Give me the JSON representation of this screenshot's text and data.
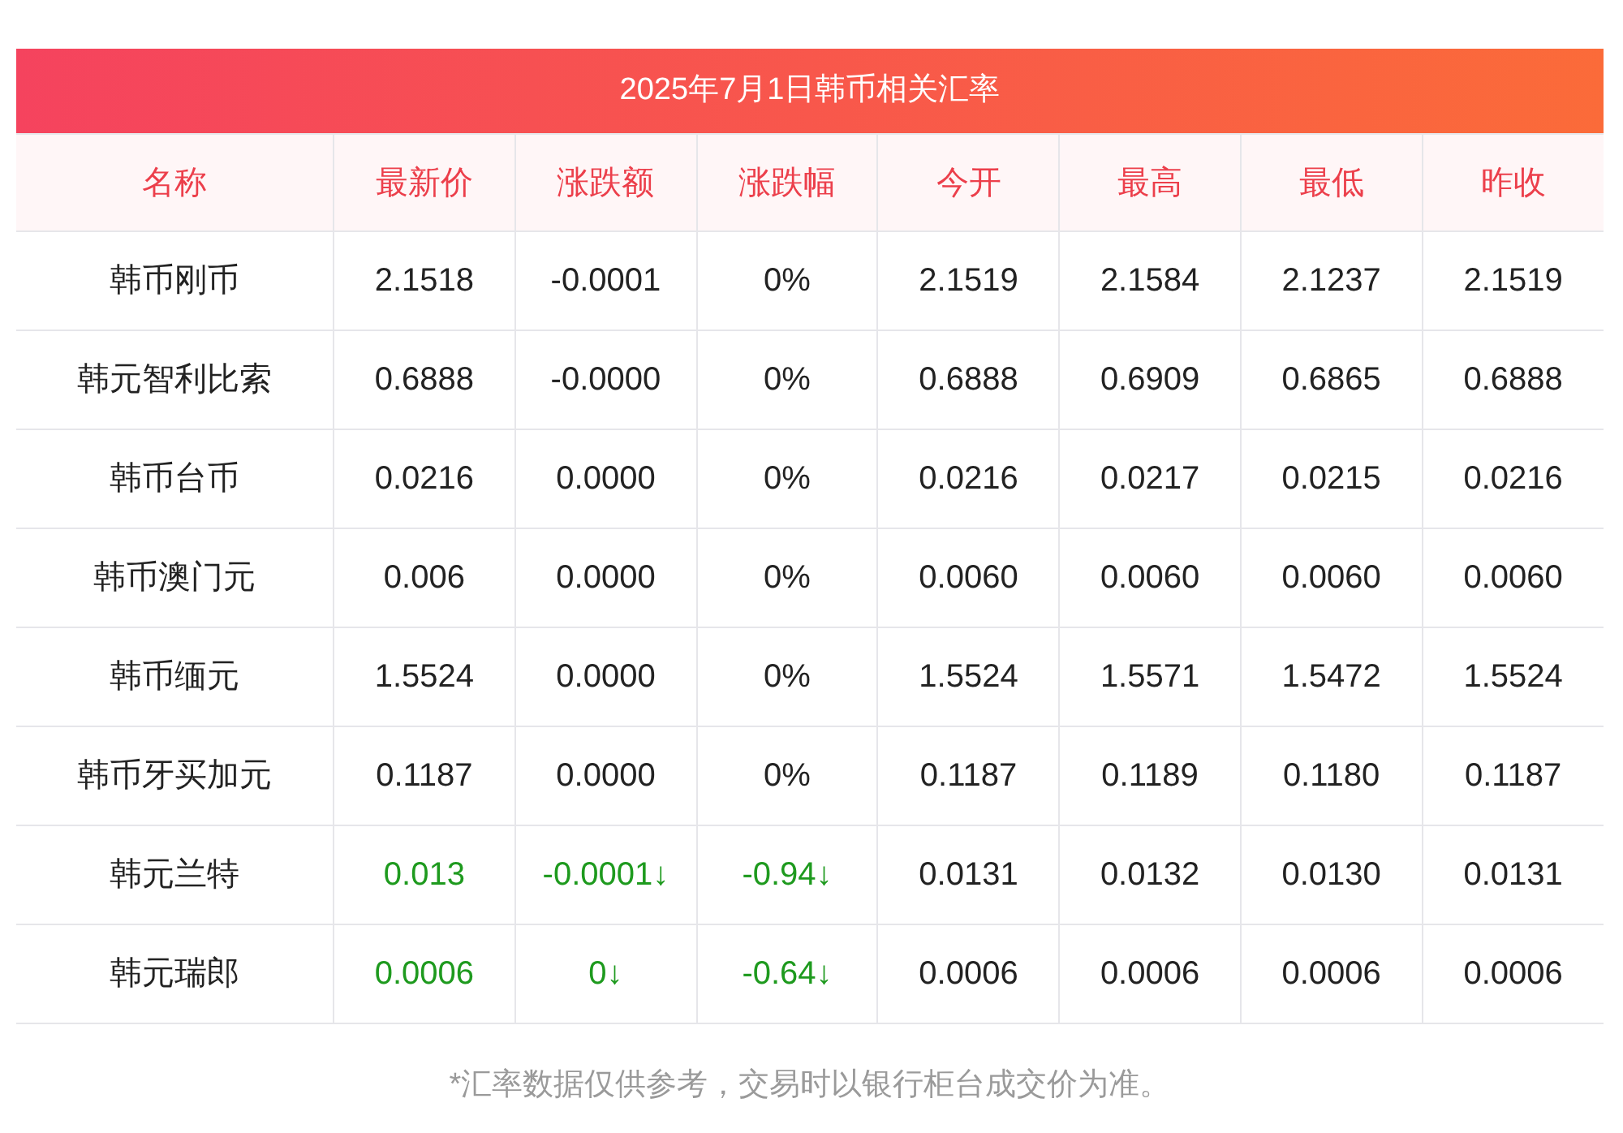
{
  "title": "2025年7月1日韩币相关汇率",
  "columns": [
    "名称",
    "最新价",
    "涨跌额",
    "涨跌幅",
    "今开",
    "最高",
    "最低",
    "昨收"
  ],
  "rows": [
    {
      "falling": false,
      "cells": [
        "韩币刚币",
        "2.1518",
        "-0.0001",
        "0%",
        "2.1519",
        "2.1584",
        "2.1237",
        "2.1519"
      ]
    },
    {
      "falling": false,
      "cells": [
        "韩元智利比索",
        "0.6888",
        "-0.0000",
        "0%",
        "0.6888",
        "0.6909",
        "0.6865",
        "0.6888"
      ]
    },
    {
      "falling": false,
      "cells": [
        "韩币台币",
        "0.0216",
        "0.0000",
        "0%",
        "0.0216",
        "0.0217",
        "0.0215",
        "0.0216"
      ]
    },
    {
      "falling": false,
      "cells": [
        "韩币澳门元",
        "0.006",
        "0.0000",
        "0%",
        "0.0060",
        "0.0060",
        "0.0060",
        "0.0060"
      ]
    },
    {
      "falling": false,
      "cells": [
        "韩币缅元",
        "1.5524",
        "0.0000",
        "0%",
        "1.5524",
        "1.5571",
        "1.5472",
        "1.5524"
      ]
    },
    {
      "falling": false,
      "cells": [
        "韩币牙买加元",
        "0.1187",
        "0.0000",
        "0%",
        "0.1187",
        "0.1189",
        "0.1180",
        "0.1187"
      ]
    },
    {
      "falling": true,
      "cells": [
        "韩元兰特",
        "0.013",
        "-0.0001↓",
        "-0.94↓",
        "0.0131",
        "0.0132",
        "0.0130",
        "0.0131"
      ]
    },
    {
      "falling": true,
      "cells": [
        "韩元瑞郎",
        "0.0006",
        "0↓",
        "-0.64↓",
        "0.0006",
        "0.0006",
        "0.0006",
        "0.0006"
      ]
    }
  ],
  "note": "*汇率数据仅供参考，交易时以银行柜台成交价为准。"
}
